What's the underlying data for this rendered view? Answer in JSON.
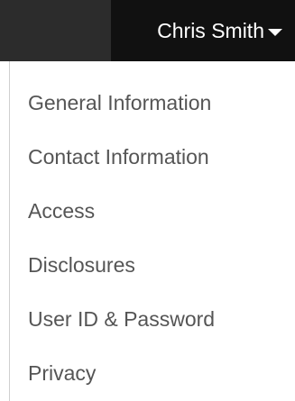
{
  "header": {
    "user_name": "Chris Smith",
    "caret_icon": "caret-down-icon",
    "colors": {
      "bar_left": "#2c2c2c",
      "bar_user": "#111111",
      "text": "#ffffff"
    }
  },
  "menu": {
    "items": [
      {
        "label": "General Information"
      },
      {
        "label": "Contact Information"
      },
      {
        "label": "Access"
      },
      {
        "label": "Disclosures"
      },
      {
        "label": "User ID & Password"
      },
      {
        "label": "Privacy"
      }
    ],
    "colors": {
      "text": "#555555",
      "border": "#cfcfcf"
    }
  }
}
